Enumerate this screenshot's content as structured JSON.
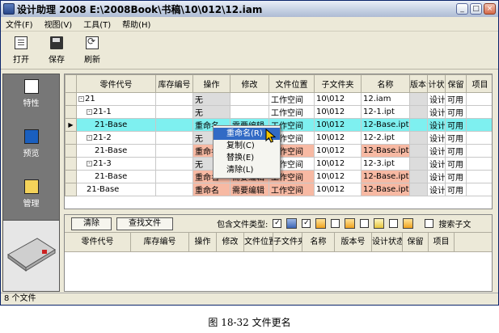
{
  "window": {
    "title": "设计助理  2008 E:\\2008Book\\书稿\\10\\012\\12.iam",
    "controls": {
      "minimize": "_",
      "maximize": "□",
      "close": "×"
    }
  },
  "menu": [
    "文件(F)",
    "视图(V)",
    "工具(T)",
    "帮助(H)"
  ],
  "toolbar": [
    {
      "label": "打开",
      "icon": "open-icon"
    },
    {
      "label": "保存",
      "icon": "save-icon"
    },
    {
      "label": "刷新",
      "icon": "refresh-icon"
    }
  ],
  "sidebar": [
    {
      "label": "特性",
      "icon": "properties-icon"
    },
    {
      "label": "预览",
      "icon": "preview-icon"
    },
    {
      "label": "管理",
      "icon": "manage-icon"
    }
  ],
  "grid": {
    "columns": [
      "零件代号",
      "库存编号",
      "操作",
      "修改",
      "文件位置",
      "子文件夹",
      "名称",
      "版本号",
      "计状",
      "保留",
      "项目"
    ],
    "rows": [
      {
        "indent": 0,
        "expander": "-",
        "name": "21",
        "stock": "",
        "action": "无",
        "modify": "",
        "location": "工作空间",
        "folder": "10\\012",
        "file": "12.iam",
        "ver": "",
        "status": "设计",
        "keep": "可用",
        "project": ""
      },
      {
        "indent": 1,
        "expander": "-",
        "name": "21-1",
        "stock": "",
        "action": "无",
        "modify": "",
        "location": "工作空间",
        "folder": "10\\012",
        "file": "12-1.ipt",
        "ver": "",
        "status": "设计",
        "keep": "可用",
        "project": ""
      },
      {
        "indent": 2,
        "expander": "",
        "name": "21-Base",
        "stock": "",
        "action": "重命名",
        "modify": "需要编辑",
        "location": "工作空间",
        "folder": "10\\012",
        "file": "12-Base.ipt",
        "ver": "",
        "status": "设计",
        "keep": "可用",
        "project": "",
        "selected": true
      },
      {
        "indent": 1,
        "expander": "-",
        "name": "21-2",
        "stock": "",
        "action": "无",
        "modify": "",
        "location": "工作空间",
        "folder": "10\\012",
        "file": "12-2.ipt",
        "ver": "",
        "status": "设计",
        "keep": "可用",
        "project": ""
      },
      {
        "indent": 2,
        "expander": "",
        "name": "21-Base",
        "stock": "",
        "action": "重命名",
        "modify": "需要编辑",
        "location": "工作空间",
        "folder": "10\\012",
        "file": "12-Base.ipt",
        "ver": "",
        "status": "设计",
        "keep": "可用",
        "project": "",
        "hl": true
      },
      {
        "indent": 1,
        "expander": "-",
        "name": "21-3",
        "stock": "",
        "action": "无",
        "modify": "",
        "location": "工作空间",
        "folder": "10\\012",
        "file": "12-3.ipt",
        "ver": "",
        "status": "设计",
        "keep": "可用",
        "project": ""
      },
      {
        "indent": 2,
        "expander": "",
        "name": "21-Base",
        "stock": "",
        "action": "重命名",
        "modify": "需要编辑",
        "location": "工作空间",
        "folder": "10\\012",
        "file": "12-Base.ipt",
        "ver": "",
        "status": "设计",
        "keep": "可用",
        "project": "",
        "hl": true
      },
      {
        "indent": 1,
        "expander": "",
        "name": "21-Base",
        "stock": "",
        "action": "重命名",
        "modify": "需要编辑",
        "location": "工作空间",
        "folder": "10\\012",
        "file": "12-Base.ipt",
        "ver": "",
        "status": "设计",
        "keep": "可用",
        "project": "",
        "hl": true
      }
    ]
  },
  "context_menu": [
    "重命名(R)",
    "复制(C)",
    "替换(E)",
    "清除(L)"
  ],
  "bottom": {
    "clear_button": "清除",
    "find_button": "查找文件",
    "filetype_label": "包含文件类型:",
    "search_sub_label": "搜索子文",
    "columns": [
      "零件代号",
      "库存编号",
      "操作",
      "修改",
      "文件位置",
      "子文件夹",
      "名称",
      "版本号",
      "设计状态",
      "保留",
      "项目"
    ]
  },
  "status": "8 个文件",
  "caption": "图 18-32  文件更名"
}
